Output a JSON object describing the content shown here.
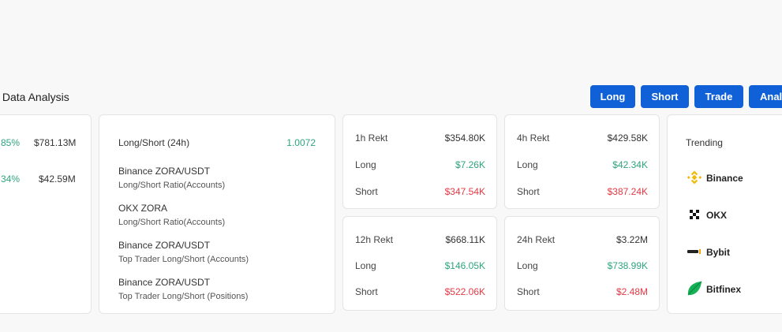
{
  "section": {
    "title": "s Data Analysis"
  },
  "buttons": {
    "long": "Long",
    "short": "Short",
    "trade": "Trade",
    "analysis": "Analy"
  },
  "card1": {
    "row1": {
      "pct": "85%",
      "value": "$781.13M"
    },
    "row2": {
      "pct": "34%",
      "value": "$42.59M"
    }
  },
  "ratio": {
    "header": {
      "label": "Long/Short (24h)",
      "value": "1.0072"
    },
    "items": [
      {
        "title": "Binance ZORA/USDT",
        "subtitle": "Long/Short Ratio(Accounts)"
      },
      {
        "title": "OKX ZORA",
        "subtitle": "Long/Short Ratio(Accounts)"
      },
      {
        "title": "Binance ZORA/USDT",
        "subtitle": "Top Trader Long/Short (Accounts)"
      },
      {
        "title": "Binance ZORA/USDT",
        "subtitle": "Top Trader Long/Short (Positions)"
      }
    ]
  },
  "rekt": [
    {
      "label": "1h Rekt",
      "total": "$354.80K",
      "long_label": "Long",
      "long": "$7.26K",
      "short_label": "Short",
      "short": "$347.54K"
    },
    {
      "label": "4h Rekt",
      "total": "$429.58K",
      "long_label": "Long",
      "long": "$42.34K",
      "short_label": "Short",
      "short": "$387.24K"
    },
    {
      "label": "12h Rekt",
      "total": "$668.11K",
      "long_label": "Long",
      "long": "$146.05K",
      "short_label": "Short",
      "short": "$522.06K"
    },
    {
      "label": "24h Rekt",
      "total": "$3.22M",
      "long_label": "Long",
      "long": "$738.99K",
      "short_label": "Short",
      "short": "$2.48M"
    }
  ],
  "trending": {
    "title": "Trending",
    "exchanges": [
      {
        "name": "Binance",
        "icon": "binance-icon"
      },
      {
        "name": "OKX",
        "icon": "okx-icon"
      },
      {
        "name": "Bybit",
        "icon": "bybit-icon"
      },
      {
        "name": "Bitfinex",
        "icon": "bitfinex-icon"
      }
    ]
  },
  "colors": {
    "accent": "#1060d8",
    "positive": "#2ea47f",
    "negative": "#e53945"
  }
}
